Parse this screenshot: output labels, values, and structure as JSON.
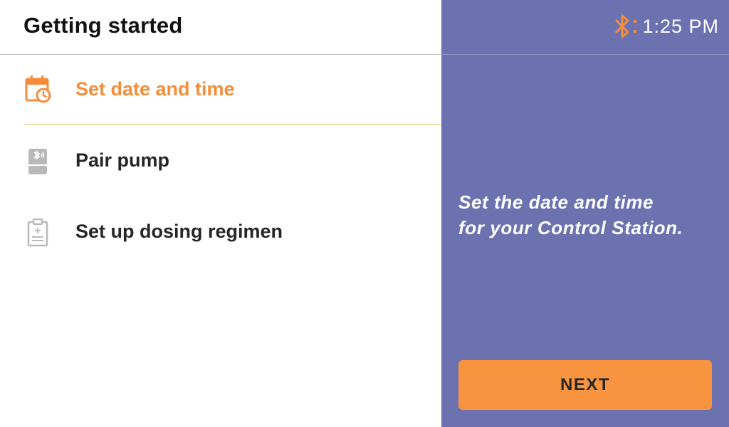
{
  "header": {
    "title": "Getting started"
  },
  "status_bar": {
    "time": "1:25 PM",
    "bluetooth_icon": "bluetooth-icon"
  },
  "steps": [
    {
      "label": "Set date and time",
      "icon": "calendar-clock-icon",
      "active": true
    },
    {
      "label": "Pair pump",
      "icon": "pump-bluetooth-icon",
      "active": false
    },
    {
      "label": "Set up dosing regimen",
      "icon": "clipboard-icon",
      "active": false
    }
  ],
  "panel": {
    "description_line1": "Set the date and time",
    "description_line2": "for your Control Station.",
    "next_label": "NEXT"
  },
  "colors": {
    "accent": "#f48d3a",
    "panel_bg": "#6c72b0",
    "button_bg": "#f89440",
    "active_divider": "#e4c25a"
  }
}
